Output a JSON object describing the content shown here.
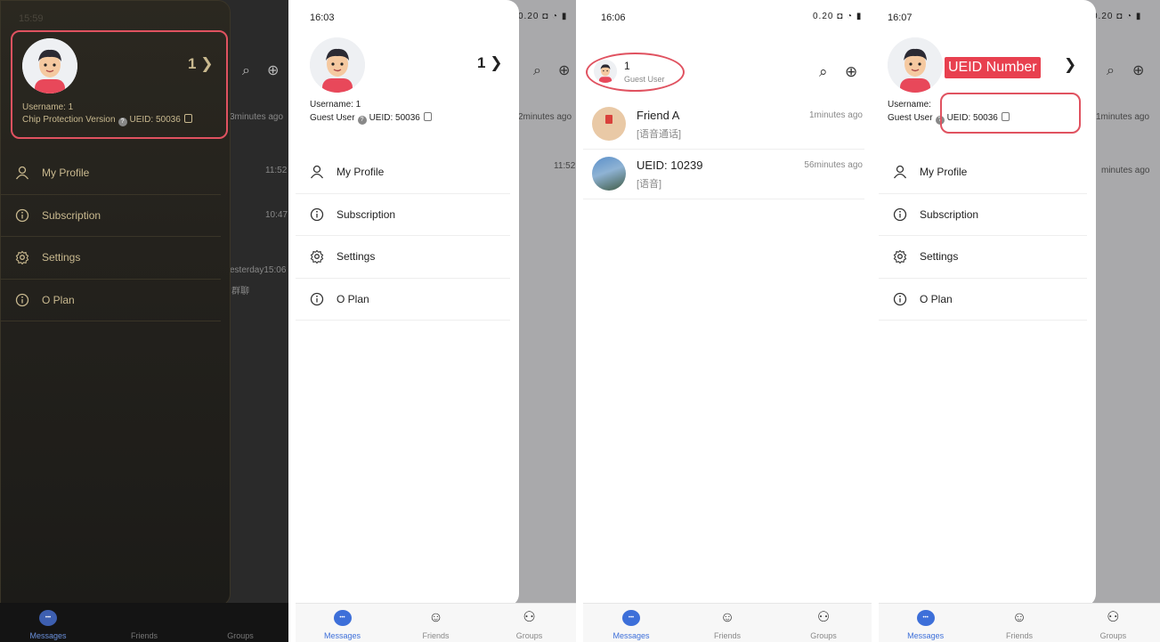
{
  "colors": {
    "accent": "#3d6fd9",
    "highlight": "#e05260",
    "gold": "#c9b98f"
  },
  "nav": {
    "messages": "Messages",
    "friends": "Friends",
    "groups": "Groups"
  },
  "menu": [
    "My Profile",
    "Subscription",
    "Settings",
    "O Plan"
  ],
  "panel1": {
    "time": "15:59",
    "count": "1",
    "username": "Username: 1",
    "version": "Chip Protection Version",
    "ueid": "UEID: 50036",
    "bg_times": [
      "3minutes ago",
      "11:52",
      "10:47",
      "esterday15:06"
    ],
    "bg_snippet": "群聊"
  },
  "panel2": {
    "time": "16:03",
    "count": "1",
    "username": "Username: 1",
    "user_type": "Guest User",
    "ueid": "UEID: 50036",
    "bg_times": [
      "2minutes ago",
      "11:52"
    ]
  },
  "panel3": {
    "time": "16:06",
    "status_icons": "0.20 ◘ ◔ ▮",
    "title": "1",
    "user_type": "Guest User",
    "chats": [
      {
        "name": "Friend A",
        "sub": "[语音通话]",
        "time": "1minutes ago"
      },
      {
        "name": "UEID: 10239",
        "sub": "[语音]",
        "time": "56minutes ago"
      }
    ]
  },
  "panel4": {
    "time": "16:07",
    "tag": "UEID Number",
    "username": "Username:",
    "user_type": "Guest User",
    "ueid": "UEID: 50036",
    "bg_times": [
      "1minutes ago",
      "minutes ago"
    ]
  }
}
